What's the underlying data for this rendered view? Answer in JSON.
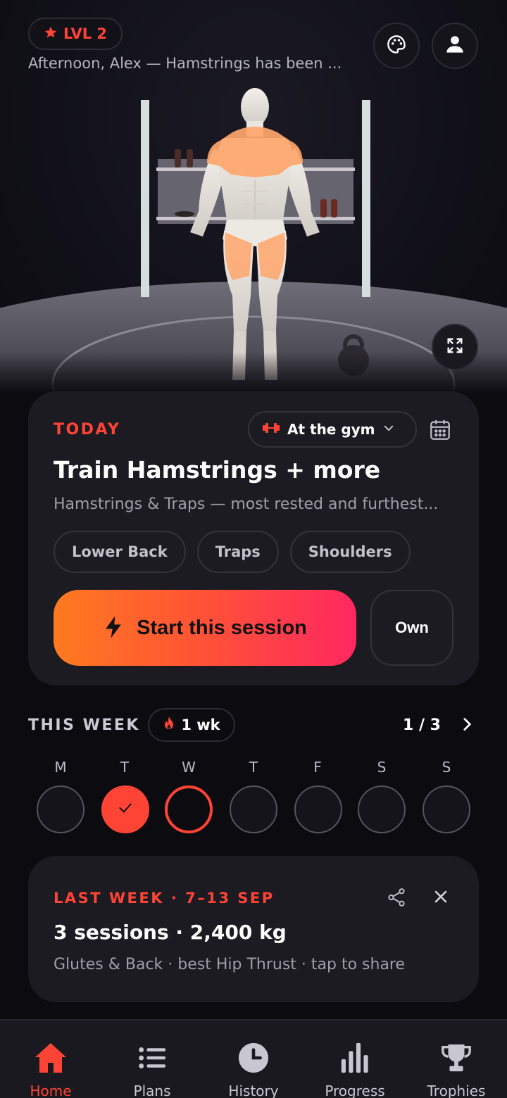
{
  "header": {
    "level_label": "LVL 2",
    "greeting": "Afternoon, Alex — Hamstrings has been ..."
  },
  "today": {
    "label": "TODAY",
    "mode": "At the gym",
    "title": "Train Hamstrings + more",
    "subtitle": "Hamstrings & Traps — most rested and furthest...",
    "chips": [
      "Lower Back",
      "Traps",
      "Shoulders"
    ],
    "start_label": "Start this session",
    "own_label": "Own"
  },
  "week": {
    "label": "THIS WEEK",
    "streak": "1 wk",
    "pager": "1 / 3",
    "days": [
      "M",
      "T",
      "W",
      "T",
      "F",
      "S",
      "S"
    ],
    "completed_days": [
      1
    ],
    "current_day": 2
  },
  "last_week": {
    "label": "LAST WEEK · 7–13 SEP",
    "title": "3 sessions · 2,400 kg",
    "subtitle": "Glutes & Back · best Hip Thrust · tap to share"
  },
  "nav": {
    "items": [
      {
        "label": "Home",
        "icon": "home-icon"
      },
      {
        "label": "Plans",
        "icon": "list-icon"
      },
      {
        "label": "History",
        "icon": "clock-icon"
      },
      {
        "label": "Progress",
        "icon": "bar-chart-icon"
      },
      {
        "label": "Trophies",
        "icon": "trophy-icon"
      }
    ],
    "active": 0
  },
  "colors": {
    "accent": "#ff4436",
    "gradient_start": "#ff7a1f",
    "gradient_end": "#ff2860",
    "card": "#1c1b22",
    "highlight_muscle": "#ffa66b"
  }
}
